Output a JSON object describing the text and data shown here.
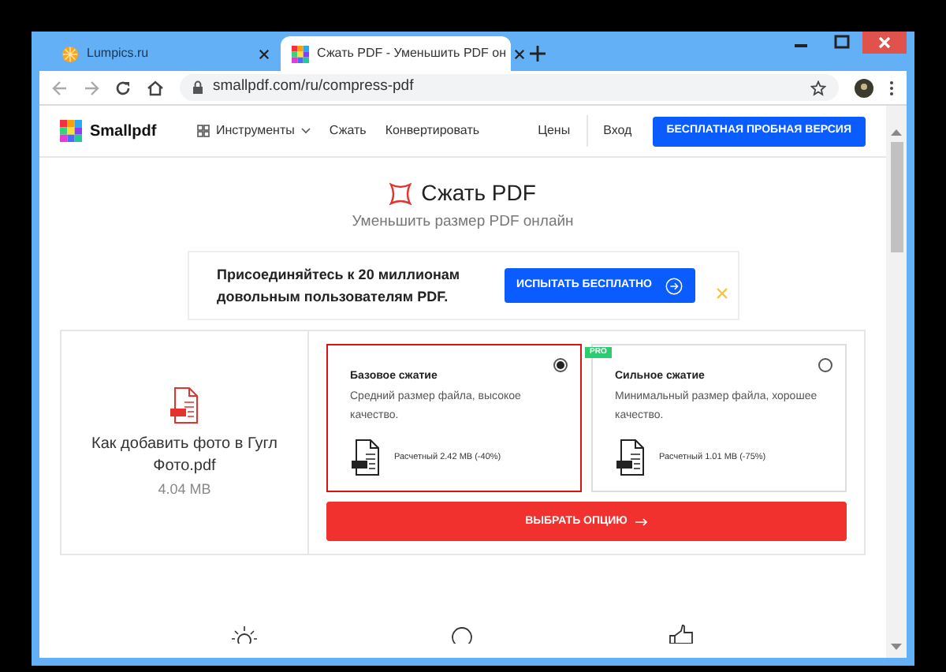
{
  "browser": {
    "tabs": [
      {
        "title": "Lumpics.ru",
        "selected": false,
        "kind": "orange"
      },
      {
        "title": "Сжать PDF - Уменьшить PDF он",
        "selected": true,
        "kind": "colorful"
      }
    ],
    "url": "smallpdf.com/ru/compress-pdf"
  },
  "site": {
    "logo": "Smallpdf",
    "nav": [
      {
        "label": "Инструменты",
        "kind": "menu"
      },
      {
        "label": "Сжать",
        "kind": "link"
      },
      {
        "label": "Конвертировать",
        "kind": "link"
      }
    ],
    "right_links": [
      "Цены",
      "Вход"
    ],
    "cta": "БЕСПЛАТНАЯ ПРОБНАЯ ВЕРСИЯ"
  },
  "hero": {
    "title": "Сжать PDF",
    "subtitle": "Уменьшить размер PDF онлайн"
  },
  "banner": {
    "text": "Присоединяйтесь к 20 миллионам довольным пользователям PDF.",
    "button": "ИСПЫТАТЬ БЕСПЛАТНО"
  },
  "file": {
    "name": "Как добавить фото в Гугл Фото.pdf",
    "size": "4.04 MB"
  },
  "options": [
    {
      "title": "Базовое сжатие",
      "description": "Средний размер файла, высокое качество.",
      "estimate": "Расчетный 2.42 MB (-40%)",
      "selected": true
    },
    {
      "title": "Сильное сжатие",
      "description": "Минимальный размер файла, хорошее качество.",
      "estimate": "Расчетный 1.01 MB (-75%)",
      "selected": false,
      "badge": "PRO"
    }
  ],
  "choose_button": "ВЫБРАТЬ ОПЦИЮ"
}
